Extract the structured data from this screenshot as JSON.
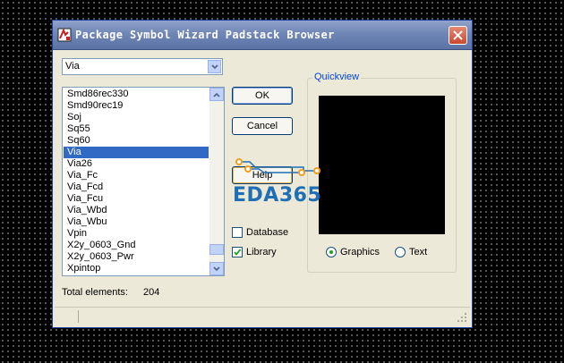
{
  "window": {
    "title": "Package Symbol Wizard Padstack Browser",
    "close_icon": "close-icon"
  },
  "filter_combo": {
    "value": "Via"
  },
  "padstack_list": {
    "items": [
      "Smd86rec330",
      "Smd90rec19",
      "Soj",
      "Sq55",
      "Sq60",
      "Via",
      "Via26",
      "Via_Fc",
      "Via_Fcd",
      "Via_Fcu",
      "Via_Wbd",
      "Via_Wbu",
      "Vpin",
      "X2y_0603_Gnd",
      "X2y_0603_Pwr",
      "Xpintop"
    ],
    "selected": "Via"
  },
  "buttons": {
    "ok": "OK",
    "cancel": "Cancel",
    "help": "Help"
  },
  "options": {
    "database_label": "Database",
    "database_checked": false,
    "library_label": "Library",
    "library_checked": true
  },
  "quickview": {
    "title": "Quickview",
    "graphics_label": "Graphics",
    "text_label": "Text",
    "selected_mode": "Graphics"
  },
  "summary": {
    "total_label": "Total elements:",
    "total_value": "204"
  },
  "watermark": {
    "text": "EDA365"
  },
  "colors": {
    "selection": "#316ac5",
    "title_bar": "#6f86b6",
    "group_title": "#0046d5",
    "watermark": "#1f6fb6"
  }
}
